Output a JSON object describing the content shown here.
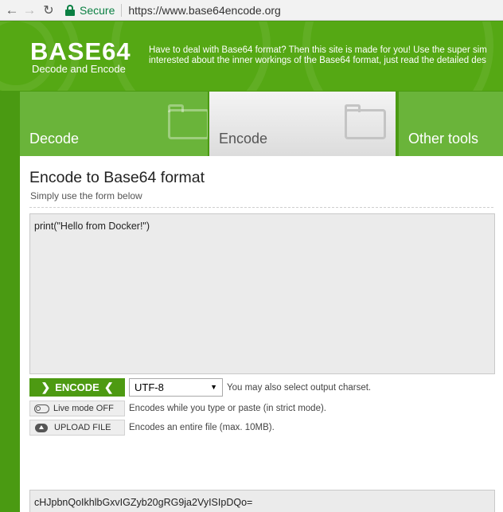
{
  "browser": {
    "back_icon": "arrow-left",
    "forward_icon": "arrow-right",
    "reload_icon": "reload",
    "secure_label": "Secure",
    "url": "https://www.base64encode.org"
  },
  "header": {
    "logo_title": "BASE64",
    "logo_subtitle": "Decode and Encode",
    "intro_line1": "Have to deal with Base64 format? Then this site is made for you! Use the super sim",
    "intro_line2": "interested about the inner workings of the Base64 format, just read the detailed des"
  },
  "tabs": [
    {
      "label": "Decode"
    },
    {
      "label": "Encode"
    },
    {
      "label": "Other tools"
    }
  ],
  "main": {
    "title": "Encode to Base64 format",
    "subtitle": "Simply use the form below",
    "input_value": "print(\"Hello from Docker!\")",
    "encode_button": "ENCODE",
    "charset_value": "UTF-8",
    "charset_hint": "You may also select output charset.",
    "live_mode_label": "Live mode OFF",
    "live_mode_desc": "Encodes while you type or paste (in strict mode).",
    "upload_label": "UPLOAD FILE",
    "upload_desc": "Encodes an entire file (max. 10MB).",
    "output_value": "cHJpbnQoIkhlbGxvIGZyb20gRG9ja2VyISIpDQo="
  },
  "colors": {
    "brand_green": "#55a814",
    "button_green": "#4d9a12"
  }
}
